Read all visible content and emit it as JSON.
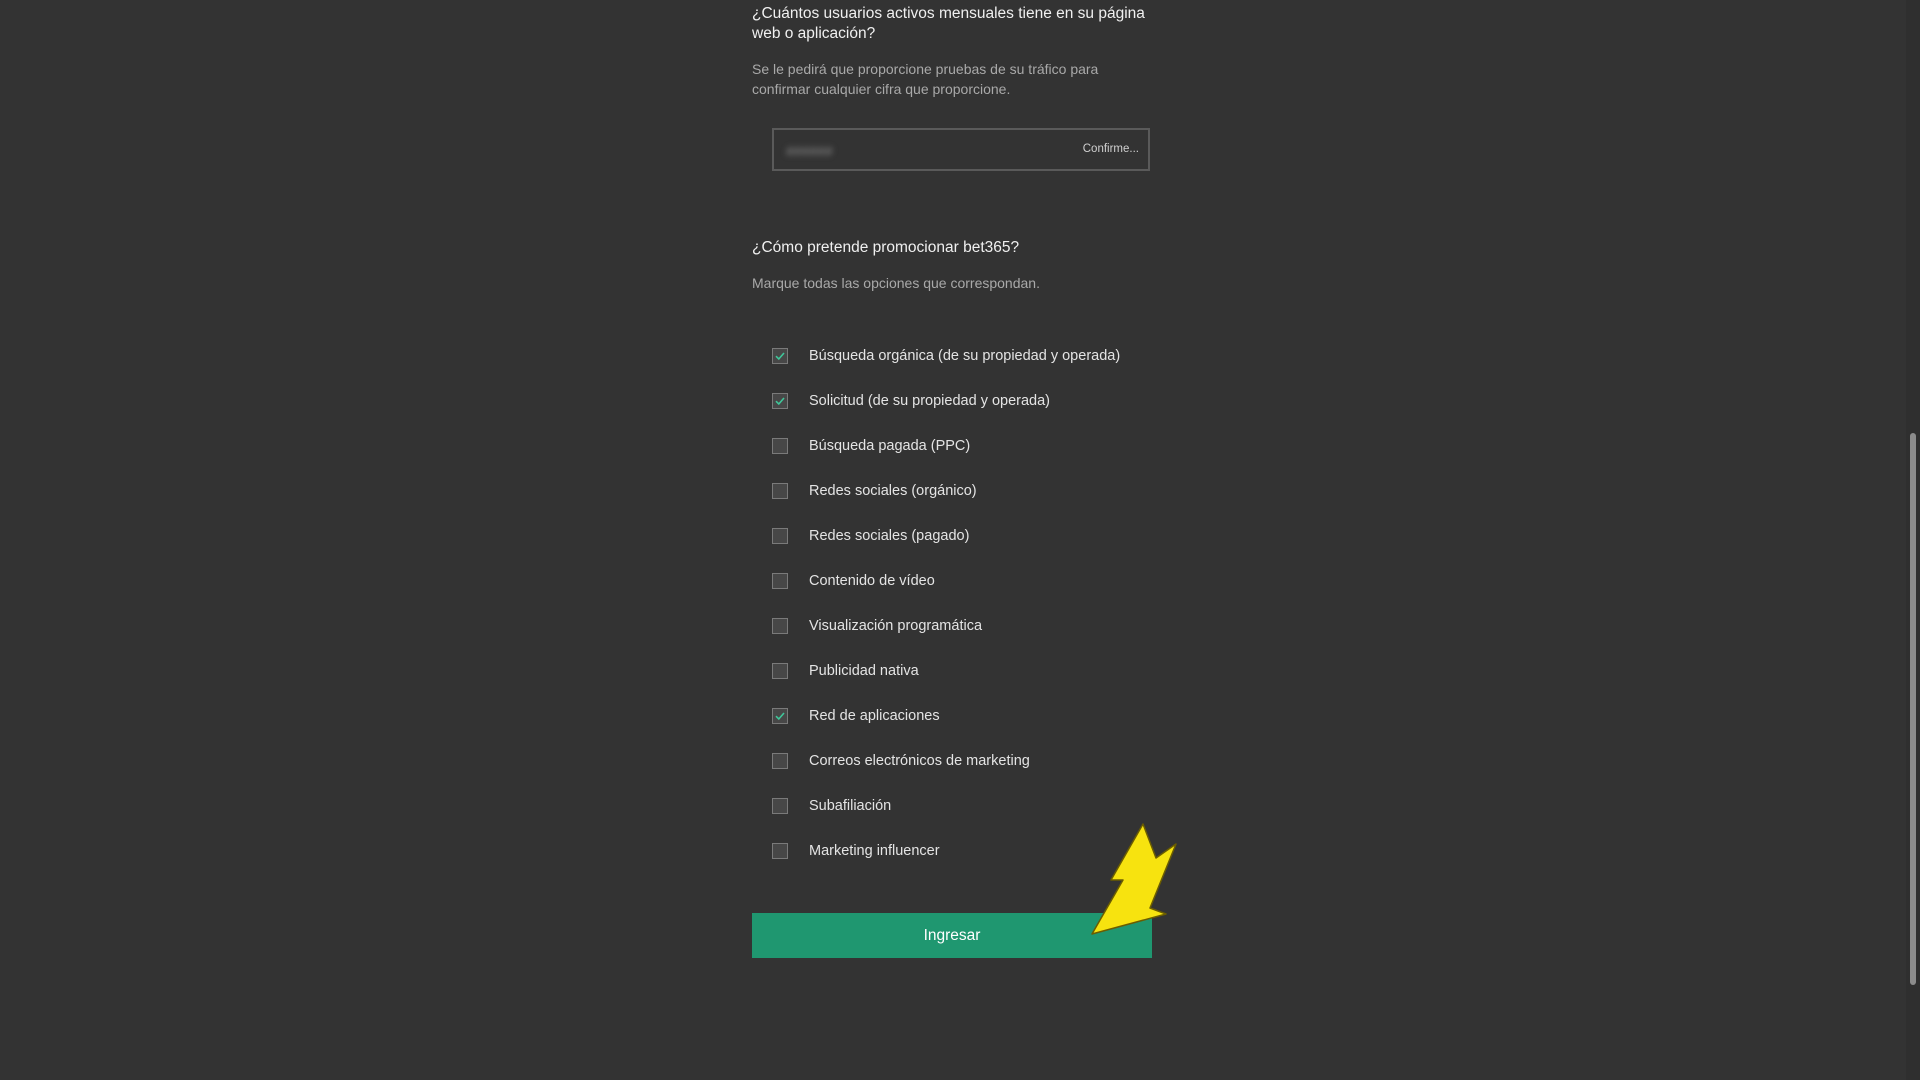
{
  "q1": {
    "title": "¿Cuántos usuarios activos mensuales tiene en su página web o aplicación?",
    "help": "Se le pedirá que proporcione pruebas de su tráfico para confirmar cualquier cifra que proporcione.",
    "input_value": "######",
    "input_hint": "Confirme..."
  },
  "q2": {
    "title": "¿Cómo pretende promocionar bet365?",
    "help": "Marque todas las opciones que correspondan.",
    "options": [
      {
        "label": "Búsqueda orgánica (de su propiedad y operada)",
        "checked": true
      },
      {
        "label": "Solicitud (de su propiedad y operada)",
        "checked": true
      },
      {
        "label": "Búsqueda pagada (PPC)",
        "checked": false
      },
      {
        "label": "Redes sociales (orgánico)",
        "checked": false
      },
      {
        "label": "Redes sociales (pagado)",
        "checked": false
      },
      {
        "label": "Contenido de vídeo",
        "checked": false
      },
      {
        "label": "Visualización programática",
        "checked": false
      },
      {
        "label": "Publicidad nativa",
        "checked": false
      },
      {
        "label": "Red de aplicaciones",
        "checked": true
      },
      {
        "label": "Correos electrónicos de marketing",
        "checked": false
      },
      {
        "label": "Subafiliación",
        "checked": false
      },
      {
        "label": "Marketing influencer",
        "checked": false
      }
    ]
  },
  "submit": {
    "label": "Ingresar"
  },
  "colors": {
    "background": "#333333",
    "submit": "#1f9770",
    "check": "#3fc79a",
    "arrow": "#f7e30f"
  },
  "icons": {
    "check": "checkmark-icon",
    "pointer": "arrow-pointer-icon"
  }
}
